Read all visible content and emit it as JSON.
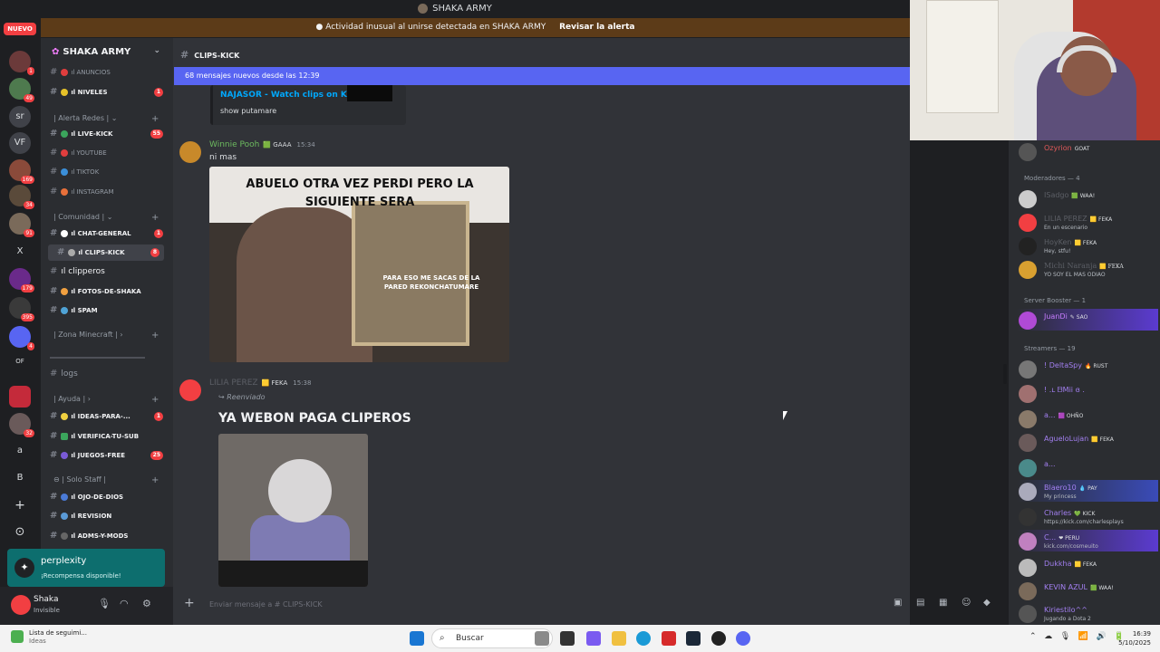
{
  "window": {
    "title": "SHAKA ARMY",
    "new_badge": "NUEVO"
  },
  "alert": {
    "text": "Actividad inusual al unirse detectada en SHAKA ARMY",
    "action": "Revisar la alerta"
  },
  "rail": {
    "servers": [
      {
        "label": "",
        "badge": "1"
      },
      {
        "label": "",
        "badge": "49"
      },
      {
        "label": "sr",
        "badge": ""
      },
      {
        "label": "VF",
        "badge": ""
      },
      {
        "label": "",
        "badge": "169"
      },
      {
        "label": "",
        "badge": "34"
      },
      {
        "label": "",
        "badge": "91"
      },
      {
        "label": "X",
        "badge": ""
      },
      {
        "label": "",
        "badge": "179"
      },
      {
        "label": "",
        "badge": "395"
      },
      {
        "label": "",
        "badge": "4"
      },
      {
        "label": "OF",
        "badge": ""
      },
      {
        "label": "",
        "badge": ""
      },
      {
        "label": "",
        "badge": "32"
      },
      {
        "label": "a",
        "badge": ""
      },
      {
        "label": "B",
        "badge": ""
      },
      {
        "label": "+",
        "badge": ""
      },
      {
        "label": "⊙",
        "badge": ""
      }
    ]
  },
  "server": {
    "name": "SHAKA ARMY"
  },
  "channels": [
    {
      "name": "ANUNCIOS",
      "badge": ""
    },
    {
      "name": "NIVELES",
      "badge": "1"
    },
    {
      "name": "LIVE-KICK",
      "badge": "55"
    },
    {
      "name": "YOUTUBE",
      "badge": ""
    },
    {
      "name": "TIKTOK",
      "badge": ""
    },
    {
      "name": "INSTAGRAM",
      "badge": ""
    },
    {
      "name": "CHAT-GENERAL",
      "badge": "1"
    },
    {
      "name": "CLIPS-KICK",
      "badge": "8"
    },
    {
      "name": "clipperos",
      "badge": ""
    },
    {
      "name": "FOTOS-DE-SHAKA",
      "badge": ""
    },
    {
      "name": "SPAM",
      "badge": ""
    },
    {
      "name": "logs",
      "badge": ""
    },
    {
      "name": "IDEAS-PARA-...",
      "badge": "1"
    },
    {
      "name": "VERIFICA-TU-SUB",
      "badge": ""
    },
    {
      "name": "JUEGOS-FREE",
      "badge": "25"
    },
    {
      "name": "OJO-DE-DIOS",
      "badge": ""
    },
    {
      "name": "REVISION",
      "badge": ""
    },
    {
      "name": "ADMS-Y-MODS",
      "badge": ""
    }
  ],
  "categories": [
    "| Alerta Redes |",
    "| Comunidad |",
    "| Zona Minecraft |",
    "| Ayuda |",
    "| Solo Staff |"
  ],
  "promo": {
    "title": "perplexity",
    "subtitle": "¡Recompensa disponible!"
  },
  "user": {
    "name": "Shaka",
    "status": "Invisible"
  },
  "chat": {
    "channel": "CLIPS-KICK",
    "new_messages": "68 mensajes nuevos desde las 12:39",
    "embed": {
      "link": "NAJASOR - Watch clips on Kick",
      "desc": "show putamare"
    },
    "msg1": {
      "author": "Winnie Pooh",
      "tag": "GAAA",
      "time": "15:34",
      "text": "ni mas",
      "meme_caption": "ABUELO OTRA VEZ PERDI PERO LA SIGUIENTE SERA",
      "meme_sub": "PARA ESO ME SACAS DE LA PARED REKONCHATUMARE"
    },
    "msg2": {
      "author": "LILIA PEREZ",
      "tag": "FEKA",
      "time": "15:38",
      "forwarded": "Reenviado",
      "text": "YA WEBON PAGA CLIPEROS"
    },
    "composer_placeholder": "Enviar mensaje a #  CLIPS-KICK"
  },
  "members": {
    "top": {
      "name": "Ozyrion",
      "tag": "GOAT"
    },
    "moderators_header": "Moderadores — 4",
    "moderators": [
      {
        "name": "ISadgo",
        "tag": "WAA!",
        "status": ""
      },
      {
        "name": "LILIA PEREZ",
        "tag": "FEKA",
        "status": "En un escenario"
      },
      {
        "name": "HoyKen",
        "tag": "FEKA",
        "status": "Hey, stfu!"
      },
      {
        "name": "Michi Naranja",
        "tag": "FEKA",
        "status": "YO SOY EL MAS ODIAO"
      }
    ],
    "boosters_header": "Server Booster — 1",
    "boosters": [
      {
        "name": "JuanDi",
        "tag": "SAO",
        "status": ""
      }
    ],
    "streamers_header": "Streamers — 19",
    "streamers": [
      {
        "name": "! DeltaSpy",
        "tag": "RUST",
        "status": ""
      },
      {
        "name": "! .ʟ ᗷMii ɞ .",
        "tag": "",
        "status": ""
      },
      {
        "name": "a...",
        "tag": "OHÑO",
        "status": ""
      },
      {
        "name": "AgueloLujan",
        "tag": "FEKA",
        "status": ""
      },
      {
        "name": "a...",
        "tag": "",
        "status": ""
      },
      {
        "name": "Blaero10",
        "tag": "PAY",
        "status": "My princess"
      },
      {
        "name": "Charles",
        "tag": "KICK",
        "status": "https://kick.com/charlesplays"
      },
      {
        "name": "C...",
        "tag": "PERU",
        "status": "kick.com/cosmeuito"
      },
      {
        "name": "Dukkha",
        "tag": "FEKA",
        "status": ""
      },
      {
        "name": "KEVIN AZUL",
        "tag": "WAA!",
        "status": ""
      },
      {
        "name": "Kiriestilo^^",
        "tag": "",
        "status": "Jugando a Dota 2"
      }
    ]
  },
  "taskbar": {
    "weather_line1": "Lista de seguimi...",
    "weather_line2": "Ideas",
    "search": "Buscar",
    "time": "16:39",
    "date": "5/10/2025"
  }
}
